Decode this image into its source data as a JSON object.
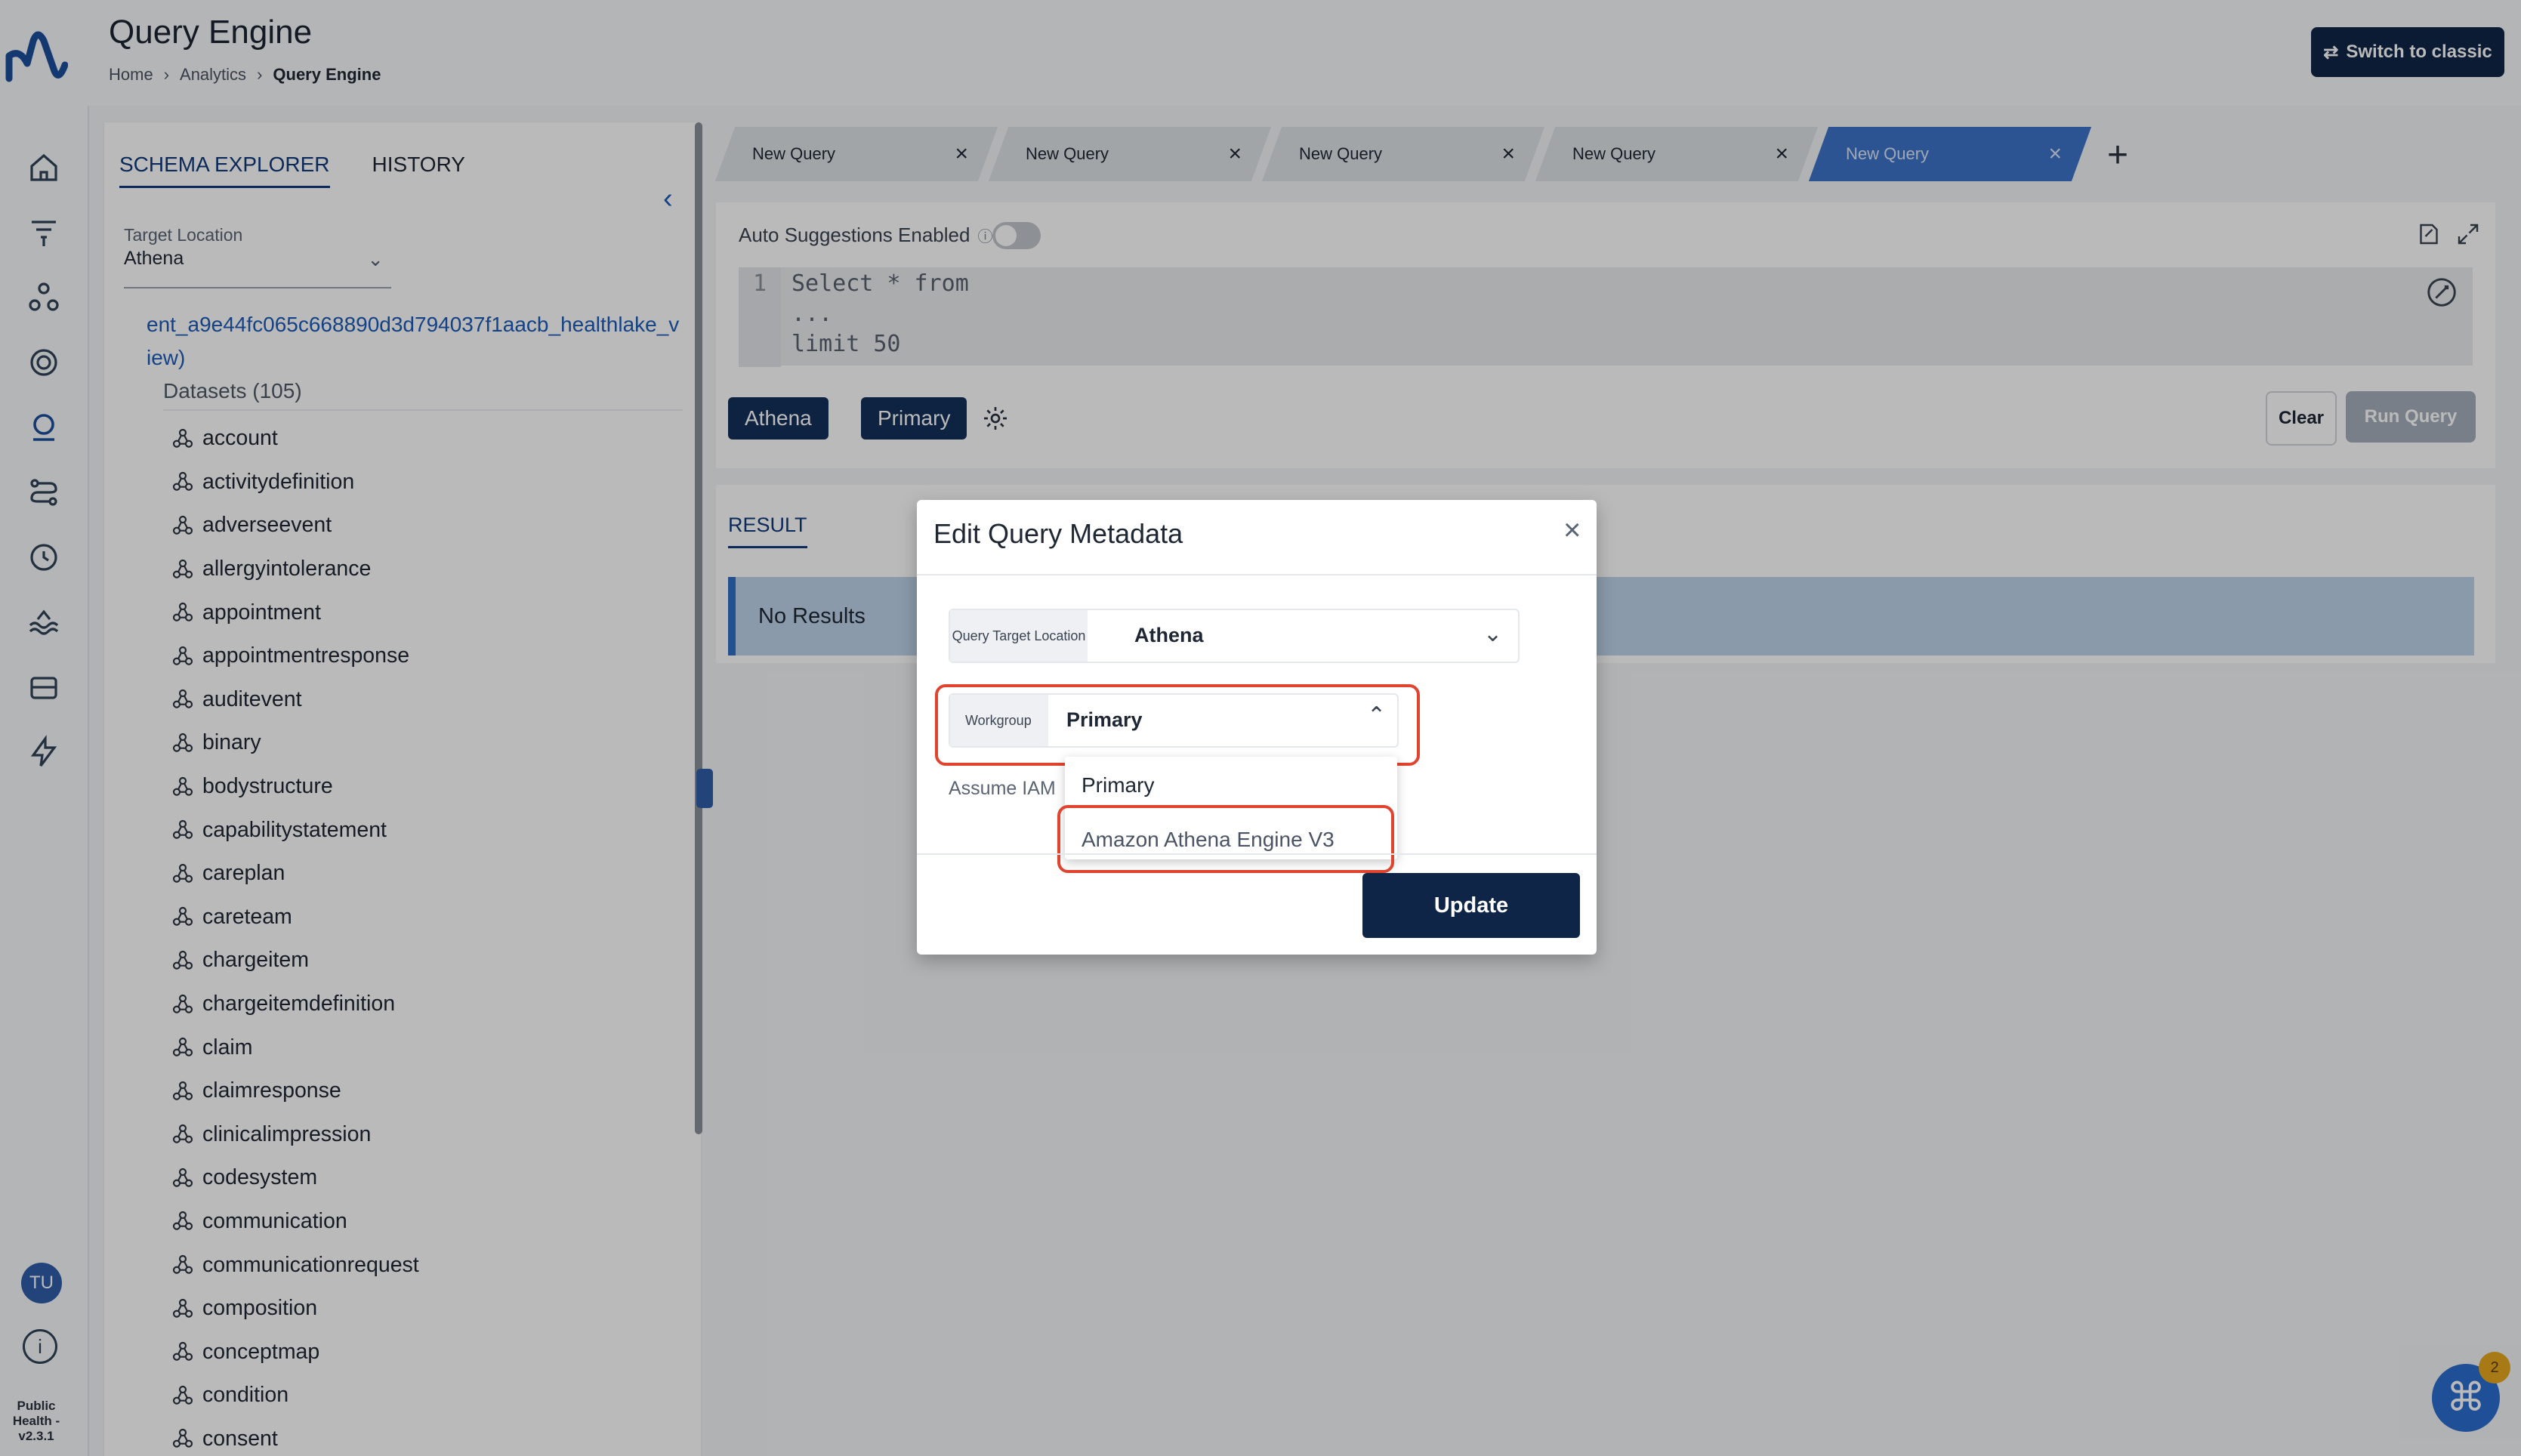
{
  "app": {
    "title": "Query Engine",
    "version": "Public Health - v2.3.1"
  },
  "breadcrumb": {
    "items": [
      "Home",
      "Analytics"
    ],
    "current": "Query Engine"
  },
  "header": {
    "switch_label": "Switch to classic"
  },
  "leftnav": {
    "icons": [
      "home-icon",
      "filter-funnel-icon",
      "graph-nodes-icon",
      "target-icon",
      "search-person-icon",
      "workflow-icon",
      "clock-icon",
      "waves-icon",
      "inbox-icon",
      "lightning-icon"
    ],
    "active": "search-person-icon",
    "avatar": "TU"
  },
  "schema": {
    "tabs": [
      "SCHEMA EXPLORER",
      "HISTORY"
    ],
    "active_tab": "SCHEMA EXPLORER",
    "target_label": "Target Location",
    "target_value": "Athena",
    "database": "ent_a9e44fc065c668890d3d794037f1aacb_healthlake_view)",
    "datasets_header": "Datasets (105)",
    "datasets": [
      "account",
      "activitydefinition",
      "adverseevent",
      "allergyintolerance",
      "appointment",
      "appointmentresponse",
      "auditevent",
      "binary",
      "bodystructure",
      "capabilitystatement",
      "careplan",
      "careteam",
      "chargeitem",
      "chargeitemdefinition",
      "claim",
      "claimresponse",
      "clinicalimpression",
      "codesystem",
      "communication",
      "communicationrequest",
      "composition",
      "conceptmap",
      "condition",
      "consent"
    ]
  },
  "query_tabs": {
    "labels": [
      "New Query",
      "New Query",
      "New Query",
      "New Query",
      "New Query"
    ],
    "active_index": 4
  },
  "editor": {
    "auto_suggest_label": "Auto Suggestions Enabled",
    "auto_suggest_on": false,
    "line_number": "1",
    "code": "Select * from\n...\nlimit 50",
    "chips": [
      "Athena",
      "Primary"
    ],
    "clear_label": "Clear",
    "run_label": "Run Query"
  },
  "result": {
    "tab": "RESULT",
    "message": "No Results"
  },
  "modal": {
    "title": "Edit Query Metadata",
    "target_label": "Query Target Location",
    "target_value": "Athena",
    "workgroup_label": "Workgroup",
    "workgroup_value": "Primary",
    "assume_label": "Assume IAM",
    "options": [
      "Primary",
      "Amazon Athena Engine V3"
    ],
    "update_label": "Update"
  },
  "fab": {
    "badge": "2"
  },
  "colors": {
    "navy": "#0f2547",
    "accent": "#2f5ea8",
    "highlight": "#e0432e",
    "active_tab": "#3d73c9"
  }
}
